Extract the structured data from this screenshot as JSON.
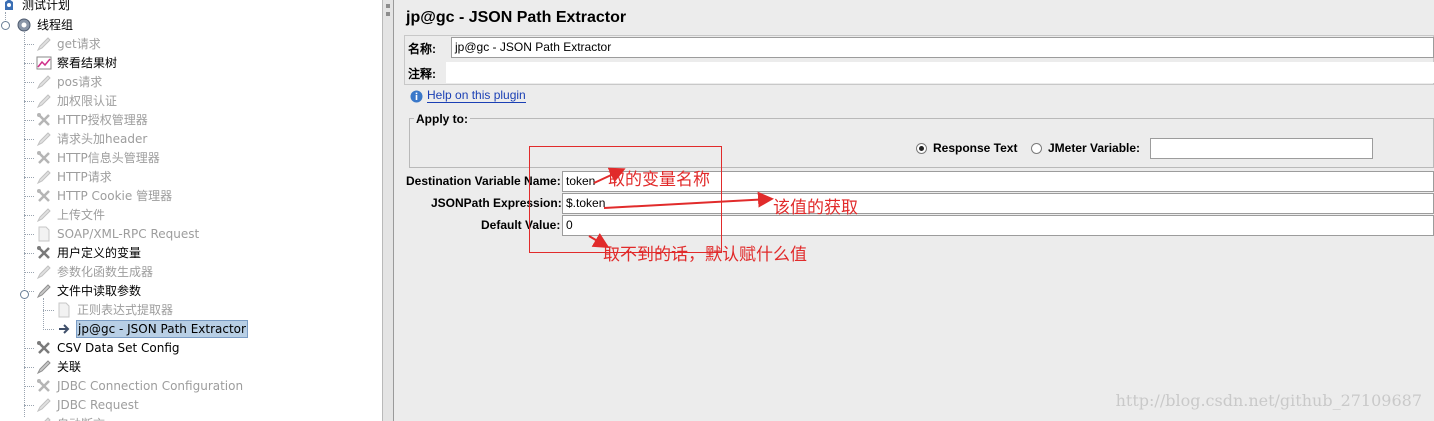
{
  "tree": {
    "root": {
      "label": "测试计划",
      "icon": "test-plan-icon"
    },
    "thread_group": {
      "label": "线程组",
      "icon": "gear-icon"
    },
    "items": [
      {
        "label": "get请求",
        "icon": "pencil-icon",
        "disabled": true
      },
      {
        "label": "察看结果树",
        "icon": "chart-icon",
        "disabled": false
      },
      {
        "label": "pos请求",
        "icon": "pencil-icon",
        "disabled": true
      },
      {
        "label": "加权限认证",
        "icon": "pencil-icon",
        "disabled": true
      },
      {
        "label": "HTTP授权管理器",
        "icon": "wrench-icon",
        "disabled": true
      },
      {
        "label": "请求头加header",
        "icon": "pencil-icon",
        "disabled": true
      },
      {
        "label": "HTTP信息头管理器",
        "icon": "wrench-icon",
        "disabled": true
      },
      {
        "label": "HTTP请求",
        "icon": "pencil-icon",
        "disabled": true
      },
      {
        "label": "HTTP Cookie 管理器",
        "icon": "wrench-icon",
        "disabled": true
      },
      {
        "label": "上传文件",
        "icon": "pencil-icon",
        "disabled": true
      },
      {
        "label": "SOAP/XML-RPC Request",
        "icon": "page-icon",
        "disabled": true
      },
      {
        "label": "用户定义的变量",
        "icon": "wrench-icon",
        "disabled": false
      },
      {
        "label": "参数化函数生成器",
        "icon": "pencil-icon",
        "disabled": true
      },
      {
        "label": "文件中读取参数",
        "icon": "pencil-icon",
        "disabled": false
      },
      {
        "label": "正则表达式提取器",
        "icon": "page-icon",
        "disabled": true
      },
      {
        "label": "jp@gc - JSON Path Extractor",
        "icon": "arrow-icon",
        "disabled": false,
        "selected": true
      },
      {
        "label": "CSV Data Set Config",
        "icon": "wrench-icon",
        "disabled": false
      },
      {
        "label": "关联",
        "icon": "pencil-icon",
        "disabled": false
      },
      {
        "label": "JDBC Connection Configuration",
        "icon": "wrench-icon",
        "disabled": true
      },
      {
        "label": "JDBC Request",
        "icon": "pencil-icon",
        "disabled": true
      },
      {
        "label": "自动断言",
        "icon": "pencil-icon",
        "disabled": true
      }
    ]
  },
  "panel": {
    "title": "jp@gc - JSON Path Extractor",
    "name_label": "名称:",
    "name_value": "jp@gc - JSON Path Extractor",
    "comment_label": "注释:",
    "comment_value": "",
    "help_link": "Help on this plugin",
    "apply_to_label": "Apply to:",
    "radio_response_text": "Response Text",
    "radio_jmeter_variable": "JMeter Variable:",
    "jmeter_variable_value": "",
    "dest_var_label": "Destination Variable Name:",
    "dest_var_value": "token",
    "jsonpath_label": "JSONPath Expression:",
    "jsonpath_value": "$.token",
    "default_label": "Default Value:",
    "default_value": "0"
  },
  "annotations": {
    "a1": "取的变量名称",
    "a2": "该值的获取",
    "a3": "取不到的话，默认赋什么值"
  },
  "colors": {
    "annotation": "#e12b2b",
    "selection": "#b8cfe5",
    "link": "#1a3fb4"
  },
  "watermark": "http://blog.csdn.net/github_27109687"
}
